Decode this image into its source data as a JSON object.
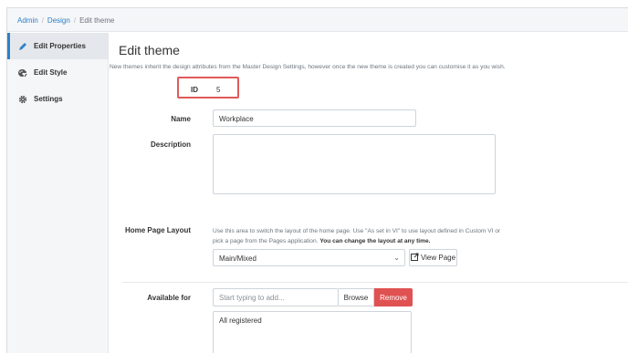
{
  "breadcrumb": {
    "items": [
      "Admin",
      "Design",
      "Edit theme"
    ]
  },
  "sidebar": {
    "items": [
      {
        "label": "Edit Properties",
        "icon": "pencil-icon",
        "active": true
      },
      {
        "label": "Edit Style",
        "icon": "palette-icon",
        "active": false
      },
      {
        "label": "Settings",
        "icon": "gear-icon",
        "active": false
      }
    ]
  },
  "main": {
    "title": "Edit theme",
    "subtitle": "New themes inherit the design attributes from the Master Design Settings, however once the new theme is created you can customise it as you wish.",
    "id_label": "ID",
    "id_value": "5",
    "name_label": "Name",
    "name_value": "Workplace",
    "description_label": "Description",
    "description_value": "",
    "layout_label": "Home Page Layout",
    "layout_help_line1": "Use this area to switch the layout of the home page. Use \"As set in VI\" to use layout defined in Custom VI or",
    "layout_help_line2": "pick a page from the Pages application.",
    "layout_help_bold": "You can change the layout at any time.",
    "layout_value": "Main/Mixed",
    "view_page_label": "View Page",
    "available_label": "Available for",
    "available_placeholder": "Start typing to add...",
    "browse_label": "Browse",
    "remove_label": "Remove",
    "available_items": [
      "All registered"
    ]
  },
  "colors": {
    "accent": "#2f80c8",
    "danger": "#e05252",
    "highlight_box": "#e05a5a"
  }
}
